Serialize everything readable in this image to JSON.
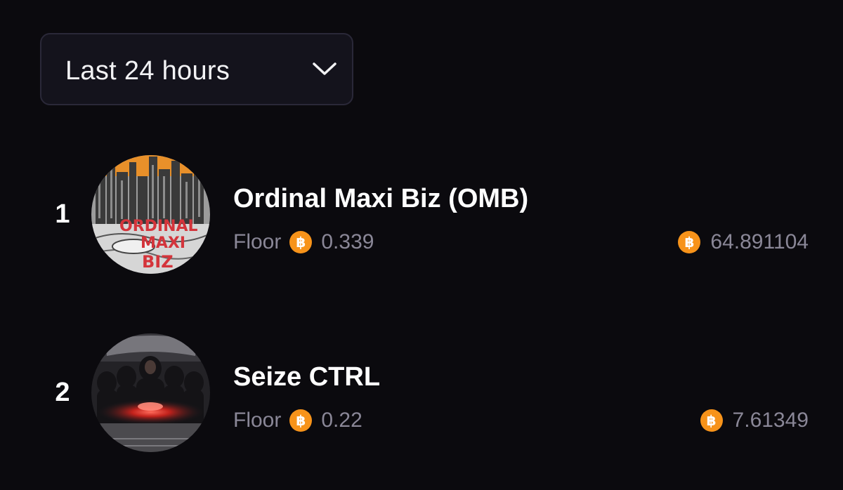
{
  "timeframe": {
    "selected": "Last 24 hours",
    "chevron_icon": "chevron-down-icon"
  },
  "collections": [
    {
      "rank": "1",
      "name": "Ordinal Maxi Biz (OMB)",
      "floor_label": "Floor",
      "floor_price": "0.339",
      "volume": "64.891104",
      "currency_icon": "bitcoin-icon"
    },
    {
      "rank": "2",
      "name": "Seize CTRL",
      "floor_label": "Floor",
      "floor_price": "0.22",
      "volume": "7.61349",
      "currency_icon": "bitcoin-icon"
    }
  ],
  "colors": {
    "background": "#0b0a0e",
    "bitcoin": "#f7931a",
    "muted_text": "#8a8797",
    "primary_text": "#ffffff"
  }
}
